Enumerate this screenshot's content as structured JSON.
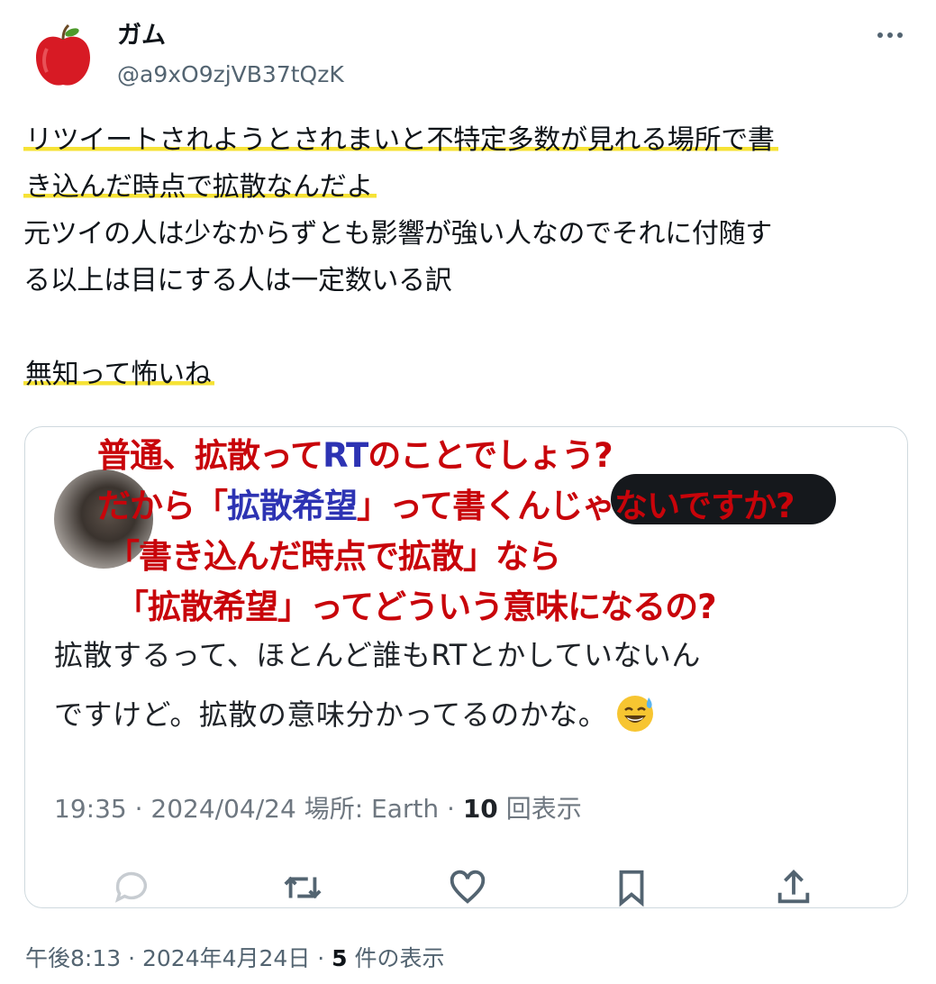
{
  "author": {
    "display_name": "ガム",
    "handle": "@a9xO9zjVB37tQzK",
    "avatar_icon": "apple-avatar"
  },
  "tweet": {
    "lines": [
      "リツイートされようとされまいと不特定多数が見れる場所で書",
      "き込んだ時点で拡散なんだよ",
      "元ツイの人は少なからずとも影響が強い人なのでそれに付随す",
      "る以上は目にする人は一定数いる訳",
      "無知って怖いね"
    ],
    "highlight_color": "#f6e235"
  },
  "quote": {
    "overlay": {
      "line1_a": "普通、拡散って",
      "line1_b": "RT",
      "line1_c": "のことでしょう?",
      "line2_a": "だから「",
      "line2_b": "拡散希望",
      "line2_c": "」って書くんじゃないですか?",
      "line3": "「書き込んだ時点で拡散」なら",
      "line4": "「拡散希望」ってどういう意味になるの?",
      "red_color": "#c8040a",
      "blue_color": "#2d33b3"
    },
    "text_line1": "拡散するって、ほとんど誰もRTとかしていないん",
    "text_line2": "ですけど。拡散の意味分かってるのかな。",
    "emoji": "sweat-smile-emoji",
    "meta": {
      "time": "19:35",
      "date": "2024/04/24",
      "location": "場所: Earth",
      "views_count": "10",
      "views_label": "回表示"
    },
    "actions": [
      "reply-icon",
      "retweet-icon",
      "like-icon",
      "bookmark-icon",
      "share-icon"
    ]
  },
  "footer": {
    "time": "午後8:13",
    "date": "2024年4月24日",
    "views_count": "5",
    "views_label": "件の表示"
  }
}
